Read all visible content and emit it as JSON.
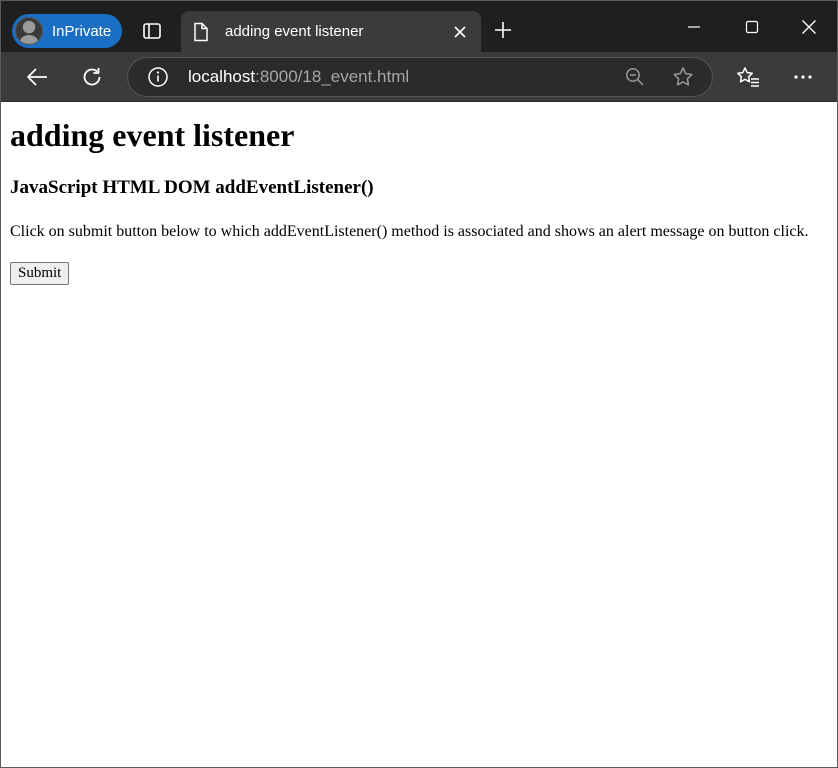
{
  "browser": {
    "profile_label": "InPrivate",
    "tab": {
      "title": "adding event listener"
    },
    "address": {
      "host": "localhost",
      "path": ":8000/18_event.html"
    },
    "theme": {
      "tabstrip": "#1f1f1f",
      "toolbar": "#3b3b3b",
      "inprivate_accent": "#1a6fc4"
    }
  },
  "page": {
    "heading": "adding event listener",
    "subheading": "JavaScript HTML DOM addEventListener()",
    "description": "Click on submit button below to which addEventListener() method is associated and shows an alert message on button click.",
    "submit_label": "Submit"
  }
}
